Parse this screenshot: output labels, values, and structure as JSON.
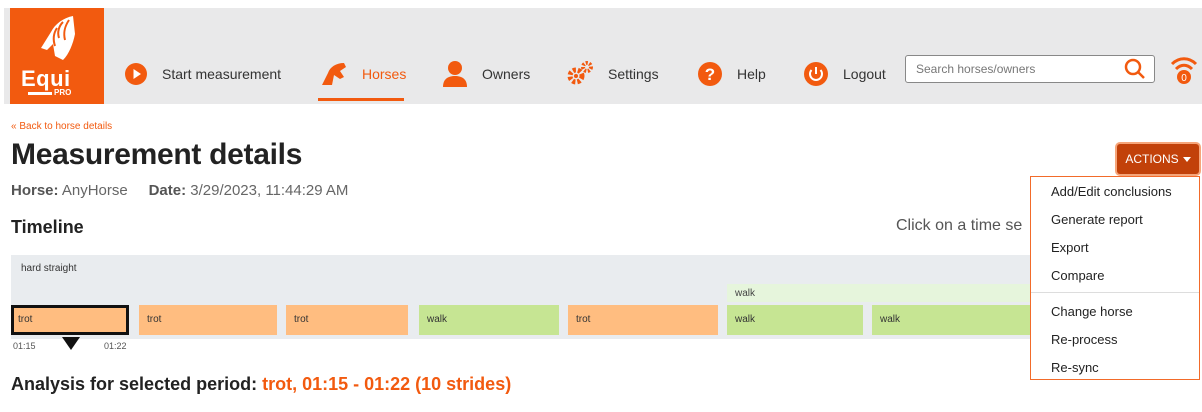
{
  "logo": {
    "text": "Equi",
    "sub": "PRO"
  },
  "nav": {
    "items": [
      {
        "label": "Start measurement",
        "icon": "play-circle-icon"
      },
      {
        "label": "Horses",
        "icon": "horse-head-icon",
        "active": true
      },
      {
        "label": "Owners",
        "icon": "user-icon"
      },
      {
        "label": "Settings",
        "icon": "gears-icon"
      },
      {
        "label": "Help",
        "icon": "question-circle-icon"
      },
      {
        "label": "Logout",
        "icon": "power-icon"
      }
    ]
  },
  "search": {
    "placeholder": "Search horses/owners",
    "value": ""
  },
  "sync_badge": "0",
  "back_link": "« Back to horse details",
  "page_title": "Measurement details",
  "meta": {
    "horse_label": "Horse:",
    "horse": "AnyHorse",
    "date_label": "Date:",
    "date": "3/29/2023, 11:44:29 AM"
  },
  "actions": {
    "label": "ACTIONS",
    "menu": [
      "Add/Edit conclusions",
      "Generate report",
      "Export",
      "Compare",
      "Change horse",
      "Re-process",
      "Re-sync"
    ]
  },
  "timeline": {
    "heading": "Timeline",
    "hint": "Click on a time se",
    "track_label": "hard straight",
    "sub_label": "walk",
    "segments": [
      {
        "label": "trot",
        "type": "trot",
        "selected": true
      },
      {
        "label": "trot",
        "type": "trot"
      },
      {
        "label": "trot",
        "type": "trot"
      },
      {
        "label": "walk",
        "type": "walk"
      },
      {
        "label": "trot",
        "type": "trot"
      },
      {
        "label": "walk",
        "type": "walk"
      },
      {
        "label": "walk",
        "type": "walk"
      }
    ],
    "selected_start": "01:15",
    "selected_end": "01:22"
  },
  "analysis": {
    "prefix": "Analysis for selected period:",
    "value": "trot, 01:15 - 01:22 (10 strides)"
  },
  "colors": {
    "accent": "#f25a0f",
    "trot": "#ffbd80",
    "walk": "#c6e593",
    "actions": "#c2410a"
  }
}
